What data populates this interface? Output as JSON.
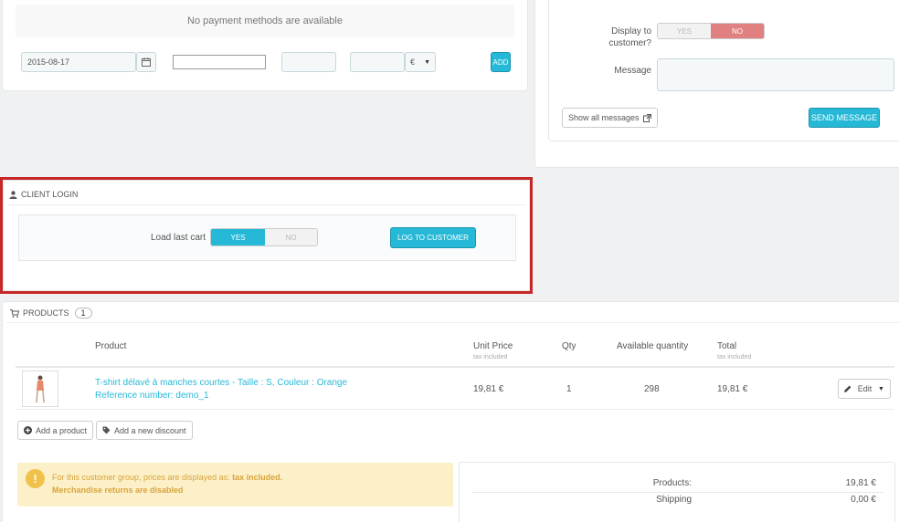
{
  "payment": {
    "no_methods": "No payment methods are available",
    "date": "2015-08-17",
    "currency": "€",
    "add_label": "ADD"
  },
  "messages": {
    "display_label_1": "Display to",
    "display_label_2": "customer?",
    "yes": "YES",
    "no": "NO",
    "message_label": "Message",
    "show_all": "Show all messages",
    "send": "SEND MESSAGE"
  },
  "client_login": {
    "title": "CLIENT LOGIN",
    "load_last_cart": "Load last cart",
    "yes": "YES",
    "no": "NO",
    "log_button": "LOG TO CUSTOMER"
  },
  "products": {
    "title": "PRODUCTS",
    "count": "1",
    "columns": {
      "product": "Product",
      "unit_price": "Unit Price",
      "unit_price_sub": "tax included",
      "qty": "Qty",
      "available": "Available quantity",
      "total": "Total",
      "total_sub": "tax included"
    },
    "rows": [
      {
        "name": "T-shirt délavé à manches courtes - Taille : S, Couleur : Orange",
        "reference": "Reference number: demo_1",
        "unit_price": "19,81 €",
        "qty": "1",
        "available": "298",
        "total": "19,81 €",
        "edit": "Edit"
      }
    ],
    "add_product": "Add a product",
    "add_discount": "Add a new discount"
  },
  "notice": {
    "line1_prefix": "For this customer group, prices are displayed as: ",
    "line1_strong": "tax included.",
    "line2": "Merchandise returns are disabled"
  },
  "totals": {
    "products_label": "Products:",
    "products_value": "19,81 €",
    "shipping_label": "Shipping",
    "shipping_value": "0,00 €"
  },
  "colors": {
    "accent": "#25b9d7",
    "highlight_border": "#c62828",
    "no_active": "#e08080",
    "warning_bg": "#fcf0c8"
  }
}
